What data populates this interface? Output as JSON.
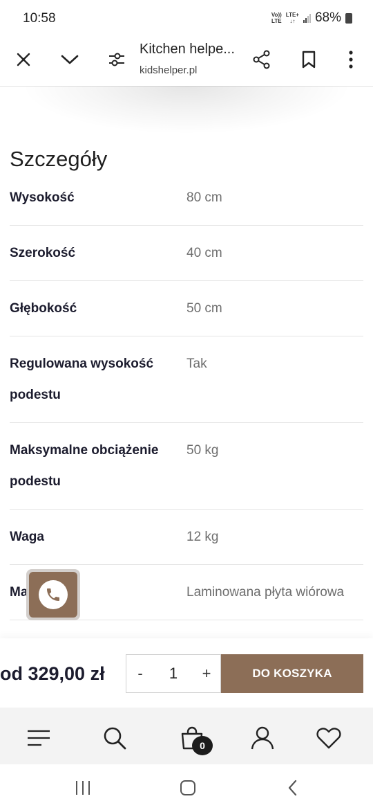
{
  "status_bar": {
    "time": "10:58",
    "volte_top": "Vo))",
    "volte_bottom": "LTE",
    "lte_top": "LTE+",
    "lte_bottom": "↓↑",
    "battery": "68%"
  },
  "browser": {
    "title": "Kitchen helpe...",
    "url": "kidshelper.pl",
    "icons": [
      "close-icon",
      "chevron-down-icon",
      "tune-icon",
      "share-icon",
      "bookmark-icon",
      "more-vert-icon"
    ]
  },
  "details": {
    "heading": "Szczegóły",
    "rows": [
      {
        "key": "Wysokość",
        "value": "80 cm"
      },
      {
        "key": "Szerokość",
        "value": "40 cm"
      },
      {
        "key": "Głębokość",
        "value": "50 cm"
      },
      {
        "key_line1": "Regulowana wysokość",
        "key_line2": "podestu",
        "value": "Tak"
      },
      {
        "key_line1": "Maksymalne obciążenie",
        "key_line2": "podestu",
        "value": "50 kg"
      },
      {
        "key": "Waga",
        "value": "12 kg"
      },
      {
        "key": "Ma",
        "value": "Laminowana płyta wiórowa"
      }
    ]
  },
  "call_button": {
    "icon": "phone-icon"
  },
  "purchase": {
    "price": "od 329,00 zł",
    "minus": "-",
    "quantity": "1",
    "plus": "+",
    "add_to_cart": "DO KOSZYKA"
  },
  "bottom_nav": {
    "icons": [
      "menu-icon",
      "search-icon",
      "cart-icon",
      "account-icon",
      "heart-icon"
    ],
    "cart_count": "0"
  },
  "system_nav": {
    "icons": [
      "recents-icon",
      "home-icon",
      "back-icon"
    ]
  },
  "colors": {
    "accent": "#8c6e57",
    "text_dark": "#1c1c2e",
    "text_muted": "#6e6e6e"
  }
}
